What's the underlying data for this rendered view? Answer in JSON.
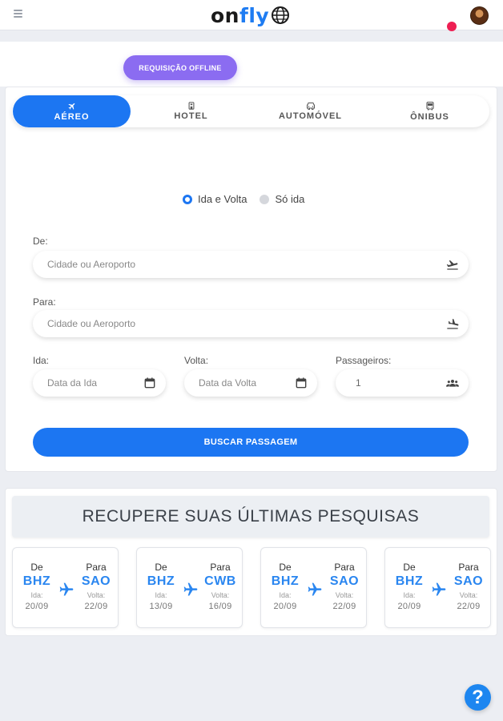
{
  "header": {
    "logo_on": "on",
    "logo_fly": "fly",
    "brand_color": "#1e7cf2",
    "notification_color": "#ee1f53"
  },
  "offline_button": {
    "label": "REQUISIÇÃO OFFLINE",
    "color": "#8b6cf1"
  },
  "tabs": [
    {
      "label": "AÉREO",
      "icon": "airplane-icon",
      "active": true
    },
    {
      "label": "HOTEL",
      "icon": "hotel-icon",
      "active": false
    },
    {
      "label": "AUTOMÓVEL",
      "icon": "car-icon",
      "active": false
    },
    {
      "label": "ÔNIBUS",
      "icon": "bus-icon",
      "active": false
    }
  ],
  "trip_type": {
    "options": [
      {
        "label": "Ida e Volta",
        "selected": true
      },
      {
        "label": "Só ida",
        "selected": false
      }
    ]
  },
  "form": {
    "from_label": "De:",
    "from_placeholder": "Cidade ou Aeroporto",
    "to_label": "Para:",
    "to_placeholder": "Cidade ou Aeroporto",
    "depart_label": "Ida:",
    "depart_placeholder": "Data da Ida",
    "return_label": "Volta:",
    "return_placeholder": "Data da Volta",
    "passengers_label": "Passageiros:",
    "passengers_value": "1",
    "search_button": "BUSCAR PASSAGEM"
  },
  "recent": {
    "title": "RECUPERE SUAS ÚLTIMAS PESQUISAS",
    "from_label": "De",
    "to_label": "Para",
    "depart_label": "Ida:",
    "return_label": "Volta:",
    "trips": [
      {
        "from": "BHZ",
        "to": "SAO",
        "depart": "20/09",
        "return": "22/09"
      },
      {
        "from": "BHZ",
        "to": "CWB",
        "depart": "13/09",
        "return": "16/09"
      },
      {
        "from": "BHZ",
        "to": "SAO",
        "depart": "20/09",
        "return": "22/09"
      },
      {
        "from": "BHZ",
        "to": "SAO",
        "depart": "20/09",
        "return": "22/09"
      }
    ]
  },
  "help_button": {
    "label": "?"
  }
}
